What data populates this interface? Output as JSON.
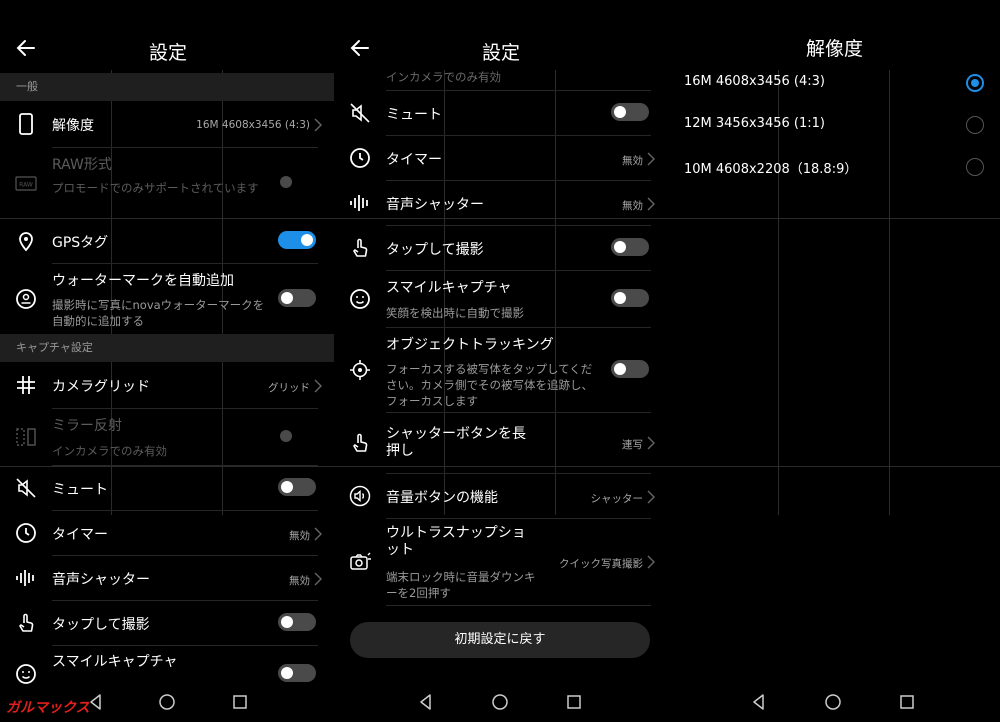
{
  "left": {
    "title": "設定",
    "section_general": "一般",
    "section_capture": "キャプチャ設定",
    "resolution": {
      "label": "解像度",
      "value": "16M 4608x3456 (4:3)"
    },
    "raw": {
      "label": "RAW形式",
      "sub": "プロモードでのみサポートされています"
    },
    "gps": {
      "label": "GPSタグ",
      "on": true
    },
    "watermark": {
      "label": "ウォーターマークを自動追加",
      "sub": "撮影時に写真にnovaウォーターマークを自動的に追加する"
    },
    "grid": {
      "label": "カメラグリッド",
      "value": "グリッド"
    },
    "mirror": {
      "label": "ミラー反射",
      "sub": "インカメラでのみ有効"
    },
    "mute": {
      "label": "ミュート"
    },
    "timer": {
      "label": "タイマー",
      "value": "無効"
    },
    "audio_shutter": {
      "label": "音声シャッター",
      "value": "無効"
    },
    "touch_capture": {
      "label": "タップして撮影"
    },
    "smile": {
      "label": "スマイルキャプチャ"
    }
  },
  "middle": {
    "title": "設定",
    "top_sub": "インカメラでのみ有効",
    "mute": {
      "label": "ミュート"
    },
    "timer": {
      "label": "タイマー",
      "value": "無効"
    },
    "audio_shutter": {
      "label": "音声シャッター",
      "value": "無効"
    },
    "touch_capture": {
      "label": "タップして撮影"
    },
    "smile": {
      "label": "スマイルキャプチャ",
      "sub": "笑顔を検出時に自動で撮影"
    },
    "tracking": {
      "label": "オブジェクトトラッキング",
      "sub": "フォーカスする被写体をタップしてください。カメラ側でその被写体を追跡し、フォーカスします"
    },
    "long_press": {
      "label": "シャッターボタンを長押し",
      "value": "連写"
    },
    "volume": {
      "label": "音量ボタンの機能",
      "value": "シャッター"
    },
    "snapshot": {
      "label": "ウルトラスナップショット",
      "value": "クイック写真撮影",
      "sub": "端末ロック時に音量ダウンキーを2回押す"
    },
    "reset_label": "初期設定に戻す"
  },
  "right": {
    "title": "解像度",
    "options": [
      {
        "label": "16M 4608x3456 (4:3)",
        "selected": true
      },
      {
        "label": "12M 3456x3456 (1:1)",
        "selected": false
      },
      {
        "label": "10M 4608x2208（18.8:9）",
        "selected": false
      }
    ]
  },
  "watermark_text": "ガルマックス",
  "colors": {
    "accent": "#1e8fe8",
    "background": "#000000",
    "section": "#1f1f1f",
    "watermark": "#e0201c"
  }
}
